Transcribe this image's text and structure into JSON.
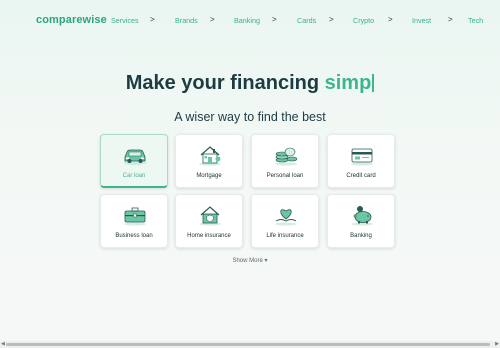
{
  "brand": {
    "name": "comparewise",
    "color": "#2aa57f"
  },
  "nav": {
    "items": [
      "Services",
      "Brands",
      "Banking",
      "Cards",
      "Crypto",
      "Invest",
      "Tech"
    ],
    "chevron": ">"
  },
  "hero": {
    "headline_prefix": "Make your financing",
    "headline_typed": "simp",
    "subhead": "A wiser way to find the best"
  },
  "categories": [
    {
      "label": "Car loan",
      "icon": "car-icon",
      "selected": true
    },
    {
      "label": "Mortgage",
      "icon": "house-icon",
      "selected": false
    },
    {
      "label": "Personal loan",
      "icon": "coins-icon",
      "selected": false
    },
    {
      "label": "Credit card",
      "icon": "credit-card-icon",
      "selected": false
    },
    {
      "label": "Business loan",
      "icon": "briefcase-icon",
      "selected": false
    },
    {
      "label": "Home insurance",
      "icon": "home-shield-icon",
      "selected": false
    },
    {
      "label": "Life insurance",
      "icon": "heart-hand-icon",
      "selected": false
    },
    {
      "label": "Banking",
      "icon": "piggy-bank-icon",
      "selected": false
    }
  ],
  "show_more": {
    "label": "Show More",
    "icon": "chevron-down-icon"
  },
  "colors": {
    "accent": "#3fb58f",
    "heading": "#1d3b42"
  }
}
